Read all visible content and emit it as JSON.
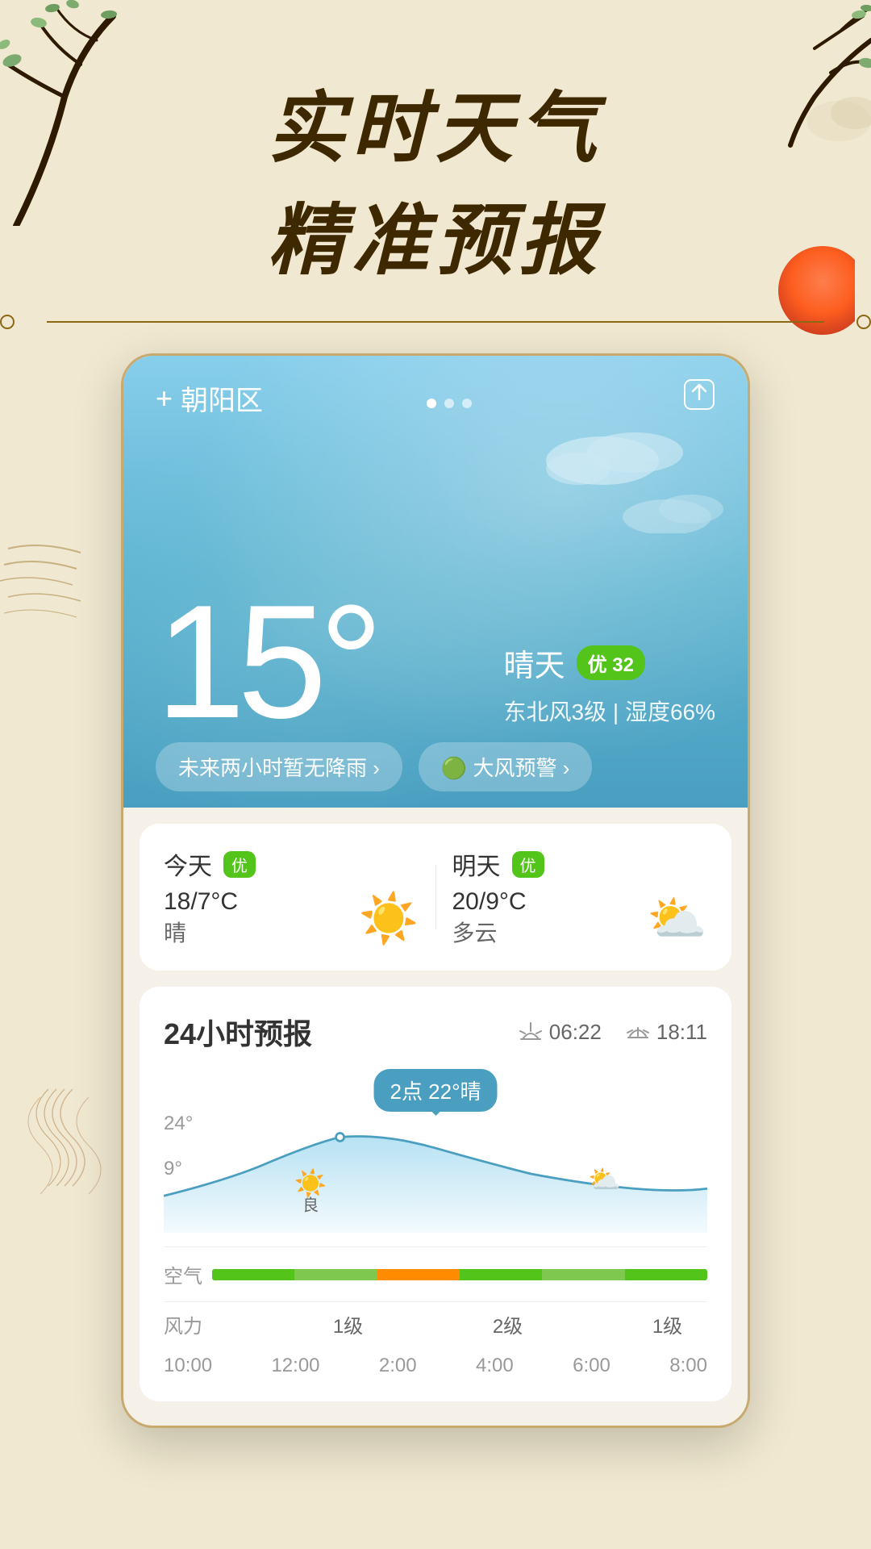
{
  "hero": {
    "title_line1": "实时天气",
    "title_line2": "精准预报"
  },
  "weather_card": {
    "location": "朝阳区",
    "add_label": "+",
    "share_icon": "⬆",
    "temperature": "15°",
    "condition": "晴天",
    "aqi_label": "优 32",
    "aqi_value": "32",
    "wind_info": "东北风3级 | 湿度66%",
    "alert1": "未来两小时暂无降雨 ›",
    "alert2": "🟢 大风预警 ›",
    "today_label": "今天",
    "today_aqi": "优",
    "today_temp": "18/7°C",
    "today_weather": "晴",
    "tomorrow_label": "明天",
    "tomorrow_aqi": "优",
    "tomorrow_temp": "20/9°C",
    "tomorrow_weather": "多云"
  },
  "hourly": {
    "title": "24小时预报",
    "sunrise": "06:22",
    "sunset": "18:11",
    "tooltip": "2点 22°晴",
    "temp_high": "24°",
    "temp_low": "9°",
    "air_label": "空气",
    "wind_label": "风力",
    "times": [
      "10:00",
      "12:00",
      "2:00",
      "4:00",
      "6:00",
      "8:00"
    ],
    "wind_levels": [
      "",
      "1级",
      "",
      "2级",
      "",
      "1级"
    ]
  },
  "icons": {
    "sun": "☀️",
    "cloud_sun": "⛅",
    "sunrise_icon": "🌅",
    "sunset_icon": "🌇"
  }
}
